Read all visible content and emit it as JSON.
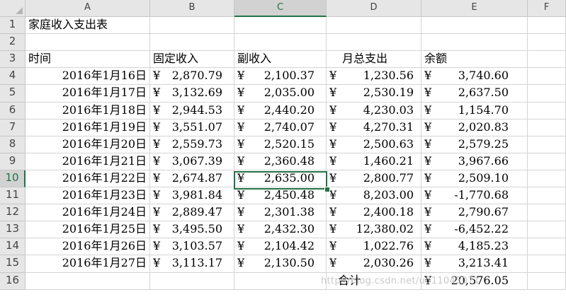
{
  "columns": [
    "A",
    "B",
    "C",
    "D",
    "E",
    "F"
  ],
  "active_column": "C",
  "active_row": "10",
  "row_numbers": [
    "1",
    "2",
    "3",
    "4",
    "5",
    "6",
    "7",
    "8",
    "9",
    "10",
    "11",
    "12",
    "13",
    "14",
    "15",
    "16"
  ],
  "title": "家庭收入支出表",
  "headers": {
    "time": "时间",
    "fixed_income": "固定收入",
    "side_income": "副收入",
    "monthly_expense": "月总支出",
    "balance": "余额"
  },
  "currency_symbol": "¥",
  "rows": [
    {
      "date": "2016年1月16日",
      "fixed": "2,870.79",
      "side": "2,100.37",
      "expense": "1,230.56",
      "balance": "3,740.60"
    },
    {
      "date": "2016年1月17日",
      "fixed": "3,132.69",
      "side": "2,035.00",
      "expense": "2,530.19",
      "balance": "2,637.50"
    },
    {
      "date": "2016年1月18日",
      "fixed": "2,944.53",
      "side": "2,440.20",
      "expense": "4,230.03",
      "balance": "1,154.70"
    },
    {
      "date": "2016年1月19日",
      "fixed": "3,551.07",
      "side": "2,740.07",
      "expense": "4,270.31",
      "balance": "2,020.83"
    },
    {
      "date": "2016年1月20日",
      "fixed": "2,559.73",
      "side": "2,520.15",
      "expense": "2,500.63",
      "balance": "2,579.25"
    },
    {
      "date": "2016年1月21日",
      "fixed": "3,067.39",
      "side": "2,360.48",
      "expense": "1,460.21",
      "balance": "3,967.66"
    },
    {
      "date": "2016年1月22日",
      "fixed": "2,674.87",
      "side": "2,635.00",
      "expense": "2,800.77",
      "balance": "2,509.10"
    },
    {
      "date": "2016年1月23日",
      "fixed": "3,981.84",
      "side": "2,450.48",
      "expense": "8,203.00",
      "balance": "-1,770.68"
    },
    {
      "date": "2016年1月24日",
      "fixed": "2,889.47",
      "side": "2,301.38",
      "expense": "2,400.18",
      "balance": "2,790.67"
    },
    {
      "date": "2016年1月25日",
      "fixed": "3,495.50",
      "side": "2,432.30",
      "expense": "12,380.02",
      "balance": "-6,452.22"
    },
    {
      "date": "2016年1月26日",
      "fixed": "3,103.57",
      "side": "2,104.42",
      "expense": "1,022.76",
      "balance": "4,185.23"
    },
    {
      "date": "2016年1月27日",
      "fixed": "3,113.17",
      "side": "2,130.50",
      "expense": "2,030.26",
      "balance": "3,213.41"
    }
  ],
  "total": {
    "label": "合计",
    "balance": "20,576.05"
  },
  "watermark": "http://blog.csdn.net/u011045071"
}
